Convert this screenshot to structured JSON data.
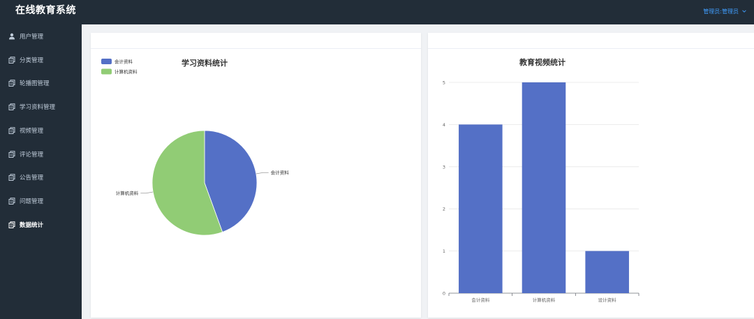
{
  "app": {
    "title": "在线教育系统"
  },
  "user_menu": {
    "label": "管理员:管理员",
    "icon": "chevron-down-icon"
  },
  "sidebar": {
    "items": [
      {
        "label": "用户管理",
        "icon": "user-icon",
        "active": false
      },
      {
        "label": "分类管理",
        "icon": "document-icon",
        "active": false
      },
      {
        "label": "轮播图管理",
        "icon": "document-icon",
        "active": false
      },
      {
        "label": "学习资料管理",
        "icon": "document-icon",
        "active": false
      },
      {
        "label": "视频管理",
        "icon": "document-icon",
        "active": false
      },
      {
        "label": "评论管理",
        "icon": "document-icon",
        "active": false
      },
      {
        "label": "公告管理",
        "icon": "document-icon",
        "active": false
      },
      {
        "label": "问题管理",
        "icon": "document-icon",
        "active": false
      },
      {
        "label": "数据统计",
        "icon": "document-icon",
        "active": true
      }
    ]
  },
  "colors": {
    "blue": "#5470c6",
    "green": "#91cc75",
    "sidebar": "#222d38",
    "link": "#409eff"
  },
  "chart_data": [
    {
      "type": "pie",
      "title": "学习资料统计",
      "legend_position": "top-left",
      "legend": [
        "会计资料",
        "计算机资料"
      ],
      "slices": [
        {
          "label": "会计资料",
          "value": 4,
          "color": "#5470c6"
        },
        {
          "label": "计算机资料",
          "value": 5,
          "color": "#91cc75"
        }
      ]
    },
    {
      "type": "bar",
      "title": "教育视频统计",
      "categories": [
        "会计资料",
        "计算机资料",
        "设计资料"
      ],
      "values": [
        4,
        5,
        1
      ],
      "ylim": [
        0,
        5
      ],
      "yticks": [
        "0",
        "1",
        "2",
        "3",
        "4",
        "5"
      ],
      "grid": true,
      "color": "#5470c6"
    }
  ]
}
